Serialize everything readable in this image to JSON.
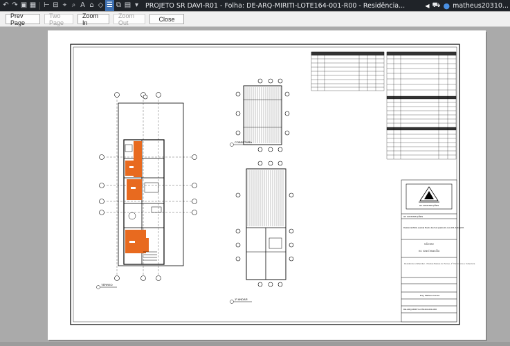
{
  "window": {
    "title": "PROJETO SR DAVI-R01 - Folha: DE-ARQ-MIRITI-LOTE164-001-R00 - Residência...",
    "user": "matheus20310..."
  },
  "toolbar": {
    "prev_page": "Prev Page",
    "two_page": "Two Page",
    "zoom_in": "Zoom In",
    "zoom_out": "Zoom Out",
    "close": "Close"
  },
  "sheet": {
    "view_terreo": "TÉRREO",
    "view_cobertura": "COBERTURA",
    "view_1andar": "1º ANDAR",
    "company": "HF CONSTRUÇÕES",
    "address": "Residencial Miriti, avenida Ilha do Juá Sul, Quadra 22, Lote 164, Salinas/PA",
    "client_label": "Cliente",
    "client_name": "Sr. Davi Basílio",
    "project_desc": "Residência Unifamiliar - Plantas Baixas do Térreo, 1º Pavimento e Cobertura",
    "designer": "Eng. Matheus Hensa",
    "sheet_code": "DE-ARQ-MIRITI-LOTE164-001-R00"
  }
}
